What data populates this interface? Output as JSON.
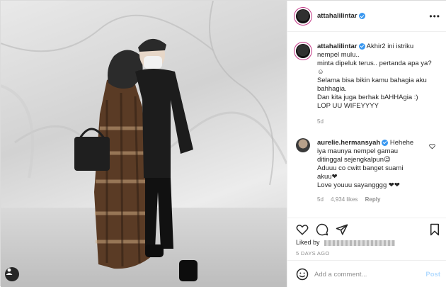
{
  "post": {
    "author": "attahalilintar",
    "caption_lines": [
      "Akhir2 ini istriku",
      "nempel mulu..",
      "minta dipeluk terus.. pertanda apa ya?",
      "☺",
      "Selama bisa bikin kamu bahagia aku",
      "bahhagia.",
      "Dan kita juga berhak bAHHAgia :)",
      "LOP UU WIFEYYYY"
    ],
    "caption_age": "5d"
  },
  "comment": {
    "author": "aurelie.hermansyah",
    "lines": [
      "Hehehe",
      "iya maunya nempel gamau",
      "ditinggal sejengkalpun😉",
      "Aduuu co cwitt banget suami",
      "akuu❤",
      "Love youuu sayangggg ❤❤"
    ],
    "age": "5d",
    "likes": "4,934 likes",
    "reply": "Reply"
  },
  "likes_prefix": "Liked by",
  "date": "5 DAYS AGO",
  "add_comment": {
    "placeholder": "Add a comment...",
    "post": "Post"
  },
  "colors": {
    "verified": "#3897f0",
    "link": "#b3dbff",
    "heart": "#ed4956"
  },
  "icons": [
    "more-options-icon",
    "verified-icon",
    "heart-icon",
    "comment-icon",
    "share-icon",
    "bookmark-icon",
    "emoji-icon",
    "tagged-user-icon"
  ]
}
